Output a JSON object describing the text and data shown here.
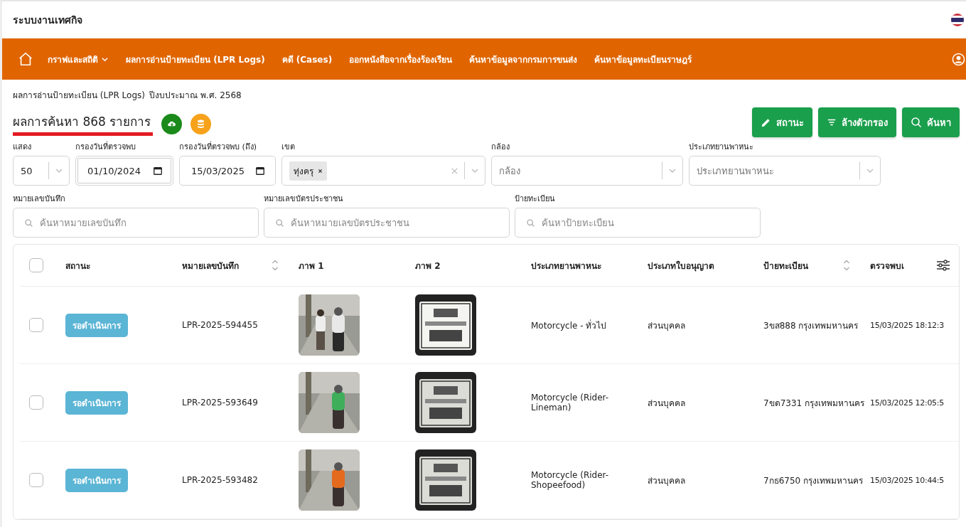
{
  "app": {
    "title": "ระบบงานเทศกิจ"
  },
  "nav": [
    {
      "label": "กราฟและสถิติ",
      "has_menu": true
    },
    {
      "label": "ผลการอ่านป้ายทะเบียน (LPR Logs)",
      "has_menu": false
    },
    {
      "label": "คดี (Cases)",
      "has_menu": false
    },
    {
      "label": "ออกหนังสือจากเรื่องร้องเรียน",
      "has_menu": false
    },
    {
      "label": "ค้นหาข้อมูลจากกรมการขนส่ง",
      "has_menu": false
    },
    {
      "label": "ค้นหาข้อมูลทะเบียนราษฎร์",
      "has_menu": false
    }
  ],
  "breadcrumb": {
    "page": "ผลการอ่านป้ายทะเบียน (LPR Logs)",
    "fiscal_year": "ปีงบประมาณ พ.ศ.  2568"
  },
  "result_title": "ผลการค้นหา 868 รายการ",
  "actions": [
    {
      "kind": "edit",
      "label": "สถานะ"
    },
    {
      "kind": "filter",
      "label": "ล้างตัวกรอง"
    },
    {
      "kind": "search",
      "label": "ค้นหา"
    }
  ],
  "filters": [
    {
      "kind": "select",
      "label": "แสดง",
      "value": "50"
    },
    {
      "kind": "date",
      "label": "กรองวันที่ตรวจพบ",
      "value": "01/10/2024",
      "focused": true
    },
    {
      "kind": "date",
      "label": "กรองวันที่ตรวจพบ (ถึง)",
      "value": "15/03/2025",
      "focused": false
    },
    {
      "kind": "multiselect",
      "label": "เขต",
      "tags": [
        "ทุ่งครุ"
      ]
    },
    {
      "kind": "select",
      "label": "กล้อง",
      "placeholder": "กล้อง"
    },
    {
      "kind": "select",
      "label": "ประเภทยานพาหนะ",
      "placeholder": "ประเภทยานพาหนะ"
    }
  ],
  "searches": [
    {
      "label": "หมายเลขบันทึก",
      "placeholder": "ค้นหาหมายเลขบันทึก"
    },
    {
      "label": "หมายเลขบัตรประชาชน",
      "placeholder": "ค้นหาหมายเลขบัตรประชาชน"
    },
    {
      "label": "ป้ายทะเบียน",
      "placeholder": "ค้นหาป้ายทะเบียน"
    }
  ],
  "table": {
    "all_checked": false,
    "columns": [
      {
        "label": "สถานะ",
        "sortable": false
      },
      {
        "label": "หมายเลขบันทึก",
        "sortable": true
      },
      {
        "label": "ภาพ 1",
        "sortable": false
      },
      {
        "label": "ภาพ 2",
        "sortable": false
      },
      {
        "label": "ประเภทยานพาหนะ",
        "sortable": false
      },
      {
        "label": "ประเภทใบอนุญาต",
        "sortable": false
      },
      {
        "label": "ป้ายทะเบียน",
        "sortable": true
      },
      {
        "label": "ตรวจพบเ"
      }
    ],
    "rows": [
      {
        "checked": false,
        "status": "รอดำเนินการ",
        "record_id": "LPR-2025-594455",
        "vehicle_type": "Motorcycle - ทั่วไป",
        "license_type": "ส่วนบุคคล",
        "plate": "3ขส888 กรุงเทพมหานคร",
        "detected_at": "15/03/2025 18:12:3"
      },
      {
        "checked": false,
        "status": "รอดำเนินการ",
        "record_id": "LPR-2025-593649",
        "vehicle_type": "Motorcycle (Rider-Lineman)",
        "license_type": "ส่วนบุคคล",
        "plate": "7ขด7331 กรุงเทพมหานคร",
        "detected_at": "15/03/2025 12:05:5"
      },
      {
        "checked": false,
        "status": "รอดำเนินการ",
        "record_id": "LPR-2025-593482",
        "vehicle_type": "Motorcycle (Rider-Shopeefood)",
        "license_type": "ส่วนบุคคล",
        "plate": "7กธ6750 กรุงเทพมหานคร",
        "detected_at": "15/03/2025 10:44:5"
      }
    ]
  }
}
